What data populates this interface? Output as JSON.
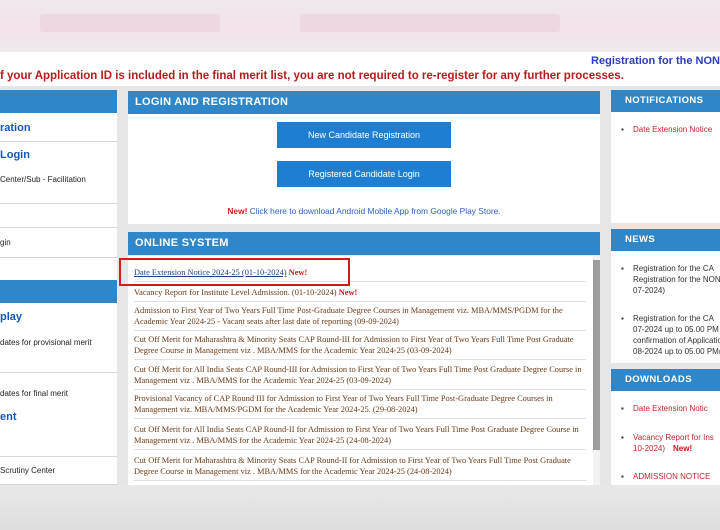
{
  "marquee": "Registration for the NON",
  "notice": "f your Application ID is included in the final merit list, you are not required to re-register for any further processes.",
  "left_sidebar": {
    "items": [
      {
        "label": "ration"
      },
      {
        "label": " Login"
      },
      {
        "label": "Center/Sub - Facilitation"
      },
      {
        "label": "gin"
      },
      {
        "label": "play"
      },
      {
        "label": "dates for provisional merit"
      },
      {
        "label": "dates for final merit"
      },
      {
        "label": "ent"
      },
      {
        "label": "Scrutiny Center"
      }
    ]
  },
  "login_panel": {
    "title": "LOGIN AND REGISTRATION",
    "new_registration_label": "New Candidate Registration",
    "registered_login_label": "Registered Candidate Login",
    "app_new": "New!",
    "app_text": "Click here to download Android Mobile App from Google Play Store."
  },
  "online_system": {
    "title": "ONLINE SYSTEM",
    "new_tag": "New!",
    "entries": [
      {
        "text": "Date Extension Notice 2024-25 (01-10-2024)",
        "new": "New!"
      },
      {
        "text": "Vacancy Report for Institute Level Admission. (01-10-2024)",
        "new": "New!"
      },
      {
        "text": "Admission to First Year of Two Years Full Time Post-Graduate Degree Courses in Management viz. MBA/MMS/PGDM for the Academic Year 2024-25 - Vacant seats after last date of reporting (09-09-2024)"
      },
      {
        "text": "Cut Off Merit for Maharashtra & Minority Seats CAP Round-III for Admission to First Year of Two Years Full Time Post Graduate Degree Course in Management viz . MBA/MMS for the Academic Year 2024-25 (03-09-2024)"
      },
      {
        "text": "Cut Off Merit for All India Seats CAP Round-III for Admission to First Year of Two Years Full Time Post Graduate Degree Course in Management viz . MBA/MMS for the Academic Year 2024-25 (03-09-2024)"
      },
      {
        "text": "Provisional Vacancy of CAP Round III for Admission to First Year of Two Years Full Time Post-Graduate Degree Courses in Management viz. MBA/MMS/PGDM for the Academic Year 2024-25. (29-08-2024)"
      },
      {
        "text": "Cut Off Merit for All India Seats CAP Round-II for Admission to First Year of Two Years Full Time Post Graduate Degree Course in Management viz . MBA/MMS for the Academic Year 2024-25 (24-08-2024)"
      },
      {
        "text": "Cut Off Merit for Maharashtra & Minority Seats CAP Round-II for Admission to First Year of Two Years Full Time Post Graduate Degree Course in Management viz . MBA/MMS for the Academic Year 2024-25 (24-08-2024)"
      }
    ]
  },
  "right_sidebar": {
    "notifications_title": "NOTIFICATIONS",
    "notifications": [
      {
        "text": "Date Extension Notice"
      }
    ],
    "news_title": "NEWS",
    "news": [
      {
        "lines": [
          "Registration for the CA",
          "Registration for the NON-",
          "07-2024)"
        ]
      },
      {
        "lines": [
          "Registration for the CA",
          "07-2024 up to 05.00 PM a",
          "confirmation of Applicatio",
          "08-2024 up to 05.00 PM(2"
        ]
      }
    ],
    "downloads_title": "DOWNLOADS",
    "downloads": [
      {
        "lines": [
          "Date Extension Notic"
        ]
      },
      {
        "lines": [
          "Vacancy Report for Ins",
          "10-2024)"
        ],
        "new": "New!"
      },
      {
        "lines": [
          "ADMISSION NOTICE"
        ]
      }
    ]
  },
  "colors": {
    "header_blue": "#2f86c8",
    "button_blue": "#1e7fd2",
    "alert_red": "#d21c1c",
    "marquee_blue": "#2c3cc4"
  }
}
